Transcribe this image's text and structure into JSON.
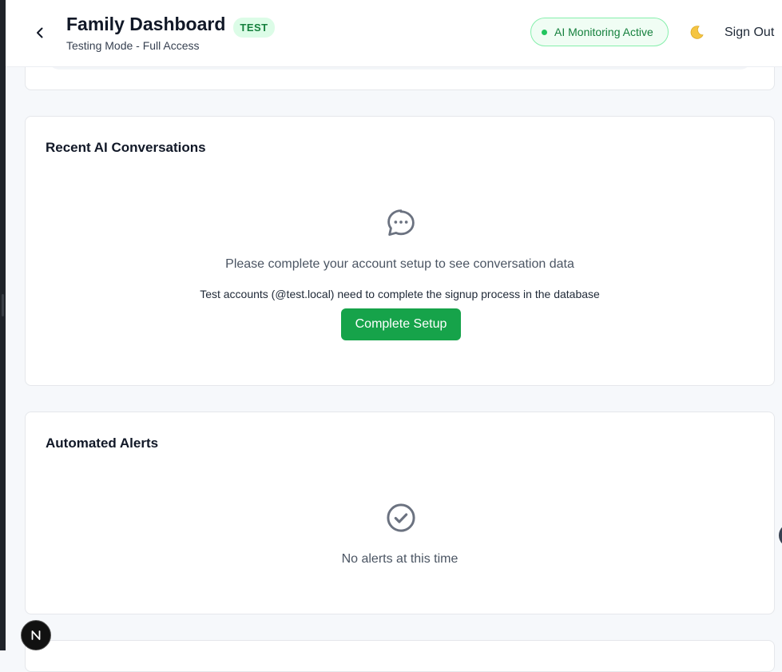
{
  "header": {
    "title": "Family Dashboard",
    "badge": "TEST",
    "subtitle": "Testing Mode - Full Access",
    "status_label": "AI Monitoring Active",
    "theme_icon": "moon-icon",
    "signout_label": "Sign Out",
    "back_icon": "chevron-left-icon"
  },
  "conversations": {
    "title": "Recent AI Conversations",
    "icon": "chat-bubble-icon",
    "message": "Please complete your account setup to see conversation data",
    "detail": "Test accounts (@test.local) need to complete the signup process in the database",
    "button_label": "Complete Setup"
  },
  "alerts": {
    "title": "Automated Alerts",
    "icon": "check-circle-icon",
    "message": "No alerts at this time"
  },
  "dev_badge": {
    "label": "N",
    "icon": "nextjs-icon"
  },
  "colors": {
    "accent_green": "#16a34a",
    "badge_bg": "#dcfce7",
    "status_dot": "#22c55e",
    "page_bg": "#f6f8fb"
  }
}
